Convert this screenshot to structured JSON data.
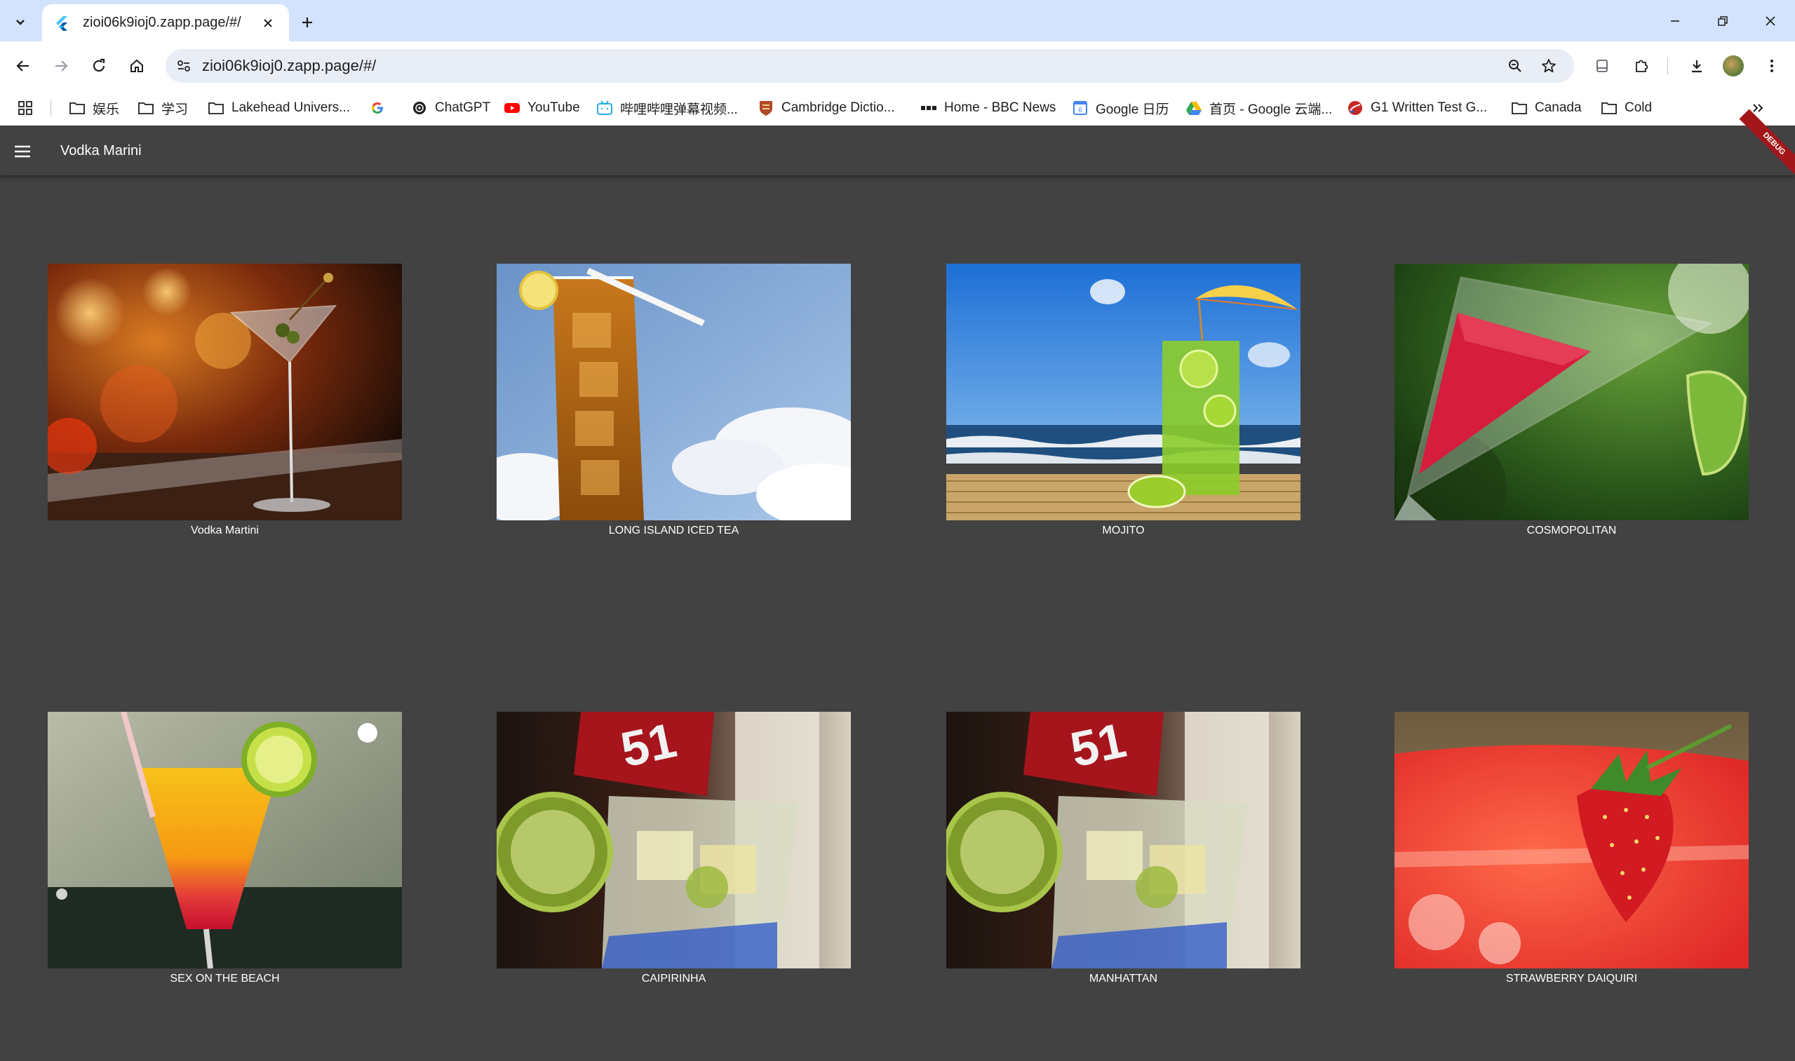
{
  "browser": {
    "tab": {
      "title": "zioi06k9ioj0.zapp.page/#/"
    },
    "address": {
      "url": "zioi06k9ioj0.zapp.page/#/"
    },
    "bookmarks": [
      {
        "label": "娱乐",
        "icon": "folder-icon"
      },
      {
        "label": "学习",
        "icon": "folder-icon"
      },
      {
        "label": "Lakehead Univers...",
        "icon": "folder-icon"
      },
      {
        "label": "",
        "icon": "google-icon"
      },
      {
        "label": "ChatGPT",
        "icon": "chatgpt-icon"
      },
      {
        "label": "YouTube",
        "icon": "youtube-icon"
      },
      {
        "label": "哔哩哔哩弹幕视频...",
        "icon": "bilibili-icon"
      },
      {
        "label": "Cambridge Dictio...",
        "icon": "cambridge-icon"
      },
      {
        "label": "Home - BBC News",
        "icon": "bbc-icon"
      },
      {
        "label": "Google 日历",
        "icon": "google-calendar-icon"
      },
      {
        "label": "首页 - Google 云端...",
        "icon": "google-drive-icon"
      },
      {
        "label": "G1 Written Test G...",
        "icon": "g1-icon"
      },
      {
        "label": "Canada",
        "icon": "folder-icon"
      },
      {
        "label": "Cold",
        "icon": "folder-icon"
      }
    ]
  },
  "app": {
    "title": "Vodka Marini",
    "debug_label": "DEBUG",
    "cocktails": [
      {
        "name": "Vodka Martini"
      },
      {
        "name": "LONG ISLAND ICED TEA"
      },
      {
        "name": "MOJITO"
      },
      {
        "name": "COSMOPOLITAN"
      },
      {
        "name": "SEX ON THE BEACH"
      },
      {
        "name": "CAIPIRINHA"
      },
      {
        "name": "MANHATTAN"
      },
      {
        "name": "STRAWBERRY DAIQUIRI"
      }
    ]
  },
  "colors": {
    "tabstrip": "#d3e3fd",
    "app_background": "#424242",
    "debug_banner": "#a3171b"
  }
}
